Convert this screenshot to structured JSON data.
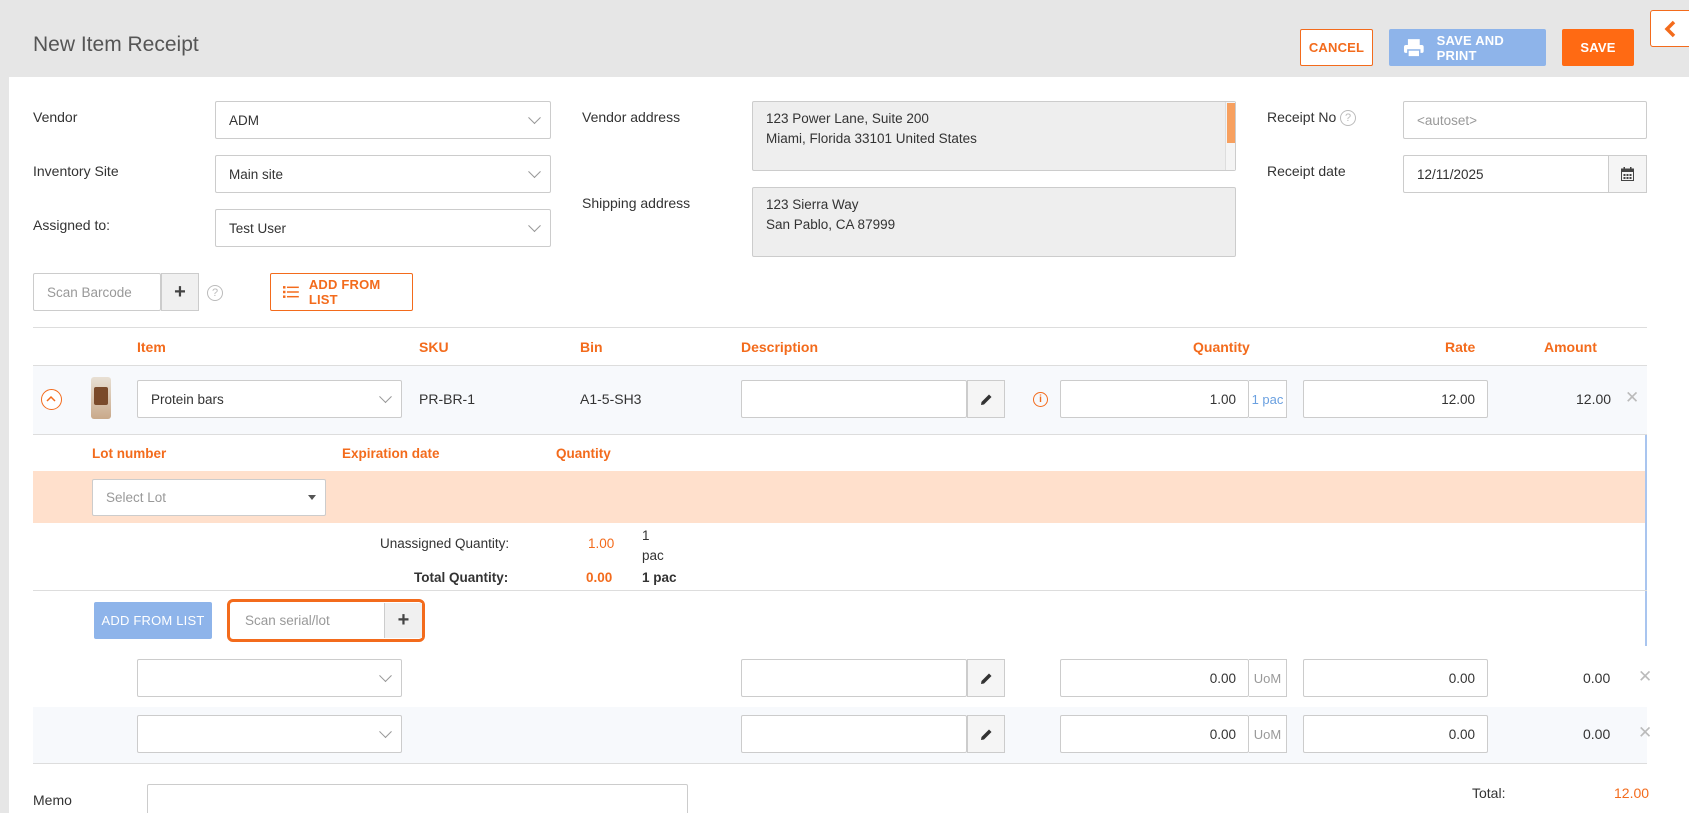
{
  "header": {
    "title": "New Item Receipt",
    "cancel_label": "CANCEL",
    "save_print_label": "SAVE AND PRINT",
    "save_label": "SAVE"
  },
  "form": {
    "vendor_label": "Vendor",
    "vendor_value": "ADM",
    "site_label": "Inventory Site",
    "site_value": "Main site",
    "assigned_label": "Assigned to:",
    "assigned_value": "Test User",
    "vendor_address_label": "Vendor address",
    "vendor_address_line1": "123 Power Lane, Suite 200",
    "vendor_address_line2": "Miami, Florida 33101 United States",
    "shipping_address_label": "Shipping address",
    "shipping_address_line1": "123 Sierra Way",
    "shipping_address_line2": "San Pablo, CA 87999",
    "receipt_no_label": "Receipt No",
    "receipt_no_placeholder": "<autoset>",
    "receipt_date_label": "Receipt date",
    "receipt_date_value": "12/11/2025"
  },
  "toolbar": {
    "scan_barcode_placeholder": "Scan Barcode",
    "add_from_list_label": "ADD FROM LIST"
  },
  "table": {
    "headers": {
      "item": "Item",
      "sku": "SKU",
      "bin": "Bin",
      "description": "Description",
      "quantity": "Quantity",
      "rate": "Rate",
      "amount": "Amount"
    },
    "row1": {
      "item": "Protein bars",
      "sku": "PR-BR-1",
      "bin": "A1-5-SH3",
      "quantity": "1.00",
      "uom": "1 pac",
      "rate": "12.00",
      "amount": "12.00"
    },
    "row2": {
      "quantity": "0.00",
      "uom": "UoM",
      "rate": "0.00",
      "amount": "0.00"
    },
    "row3": {
      "quantity": "0.00",
      "uom": "UoM",
      "rate": "0.00",
      "amount": "0.00"
    }
  },
  "lots": {
    "lot_header": "Lot number",
    "exp_header": "Expiration date",
    "qty_header": "Quantity",
    "select_placeholder": "Select Lot",
    "unassigned_label": "Unassigned Quantity:",
    "unassigned_value": "1.00",
    "unassigned_uom_line1": "1",
    "unassigned_uom_line2": "pac",
    "total_label": "Total Quantity:",
    "total_value": "0.00",
    "total_uom": "1 pac",
    "add_from_list_label": "ADD FROM LIST",
    "scan_placeholder": "Scan serial/lot"
  },
  "footer": {
    "memo_label": "Memo",
    "total_label": "Total:",
    "total_value": "12.00"
  },
  "colors": {
    "accent": "#f36b1c",
    "blue": "#8eb4ea"
  }
}
